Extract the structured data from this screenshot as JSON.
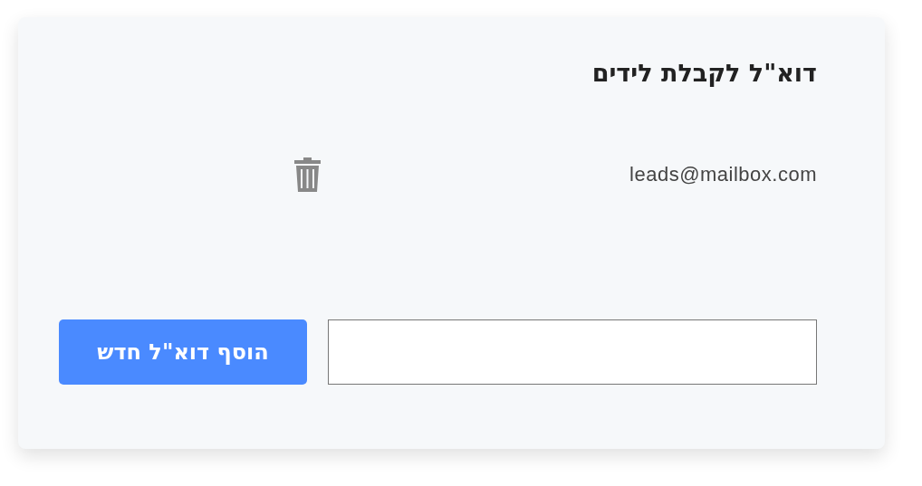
{
  "card": {
    "title": "דוא\"ל לקבלת לידים",
    "emails": [
      {
        "address": "leads@mailbox.com"
      }
    ],
    "add_button": {
      "label": "הוסף דוא\"ל חדש"
    }
  }
}
